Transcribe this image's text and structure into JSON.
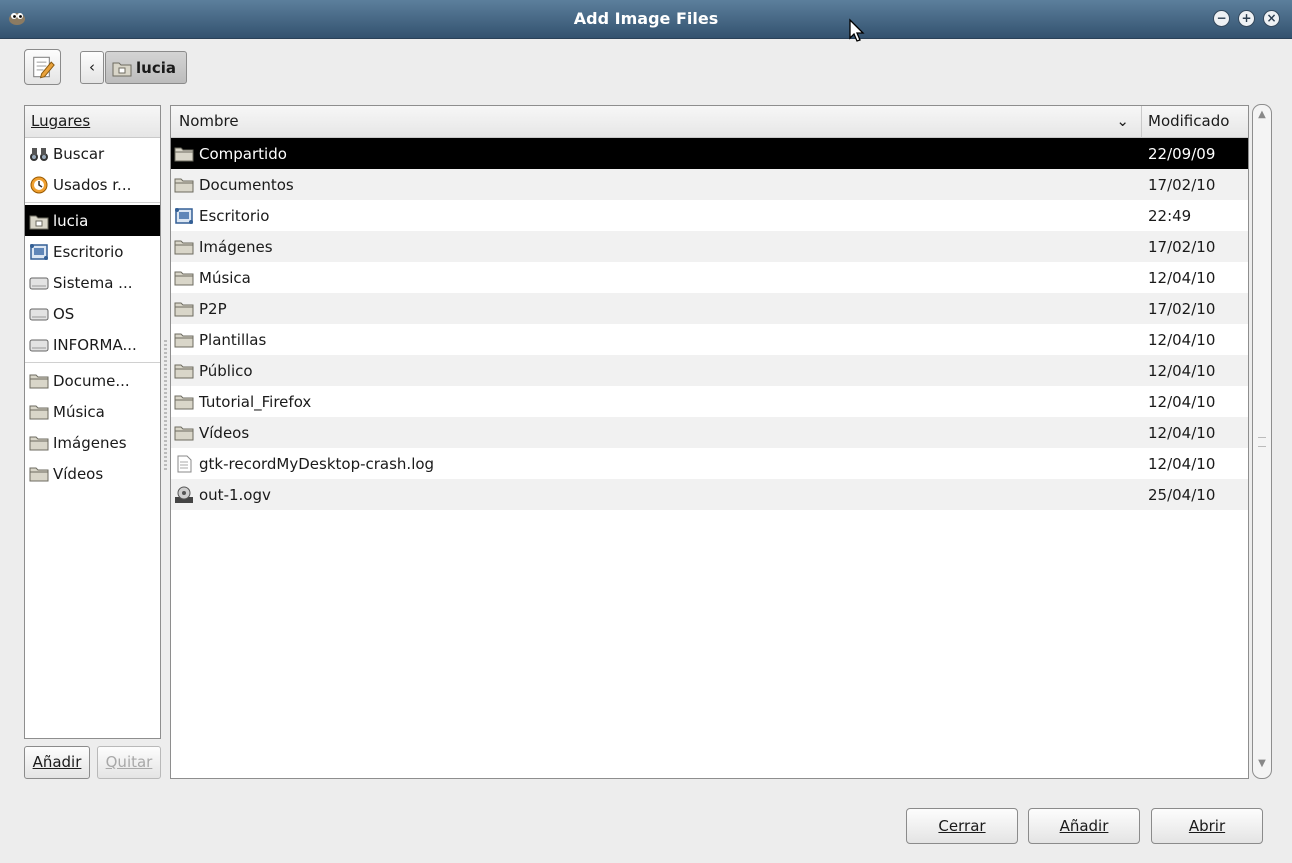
{
  "window": {
    "title": "Add Image Files",
    "app_icon": "gimp-wilber-icon",
    "controls": [
      "minimize-icon",
      "maximize-icon",
      "close-icon"
    ]
  },
  "pathbar": {
    "edit_icon": "pencil-document-icon",
    "back_label": "‹",
    "crumb_label": "lucia"
  },
  "places": {
    "header": "Lugares",
    "items": [
      {
        "label": "Buscar",
        "icon": "binoculars-icon"
      },
      {
        "label": "Usados r...",
        "icon": "recent-icon"
      },
      {
        "label": "lucia",
        "icon": "home-folder-icon",
        "selected": true
      },
      {
        "label": "Escritorio",
        "icon": "desktop-icon"
      },
      {
        "label": "Sistema ...",
        "icon": "drive-icon"
      },
      {
        "label": "OS",
        "icon": "drive-icon"
      },
      {
        "label": "INFORMA...",
        "icon": "drive-icon"
      },
      {
        "label": "Docume...",
        "icon": "folder-icon"
      },
      {
        "label": "Música",
        "icon": "folder-icon"
      },
      {
        "label": "Imágenes",
        "icon": "folder-icon"
      },
      {
        "label": "Vídeos",
        "icon": "folder-icon"
      }
    ],
    "add_label": "Añadir",
    "remove_label": "Quitar"
  },
  "files": {
    "col_name": "Nombre",
    "col_modified": "Modificado",
    "rows": [
      {
        "name": "Compartido",
        "modified": "22/09/09",
        "icon": "folder-icon",
        "selected": true
      },
      {
        "name": "Documentos",
        "modified": "17/02/10",
        "icon": "folder-icon"
      },
      {
        "name": "Escritorio",
        "modified": "22:49",
        "icon": "desktop-icon"
      },
      {
        "name": "Imágenes",
        "modified": "17/02/10",
        "icon": "folder-icon"
      },
      {
        "name": "Música",
        "modified": "12/04/10",
        "icon": "folder-icon"
      },
      {
        "name": "P2P",
        "modified": "17/02/10",
        "icon": "folder-icon"
      },
      {
        "name": "Plantillas",
        "modified": "12/04/10",
        "icon": "folder-icon"
      },
      {
        "name": "Público",
        "modified": "12/04/10",
        "icon": "folder-icon"
      },
      {
        "name": "Tutorial_Firefox",
        "modified": "12/04/10",
        "icon": "folder-icon"
      },
      {
        "name": "Vídeos",
        "modified": "12/04/10",
        "icon": "folder-icon"
      },
      {
        "name": "gtk-recordMyDesktop-crash.log",
        "modified": "12/04/10",
        "icon": "text-file-icon"
      },
      {
        "name": "out-1.ogv",
        "modified": "25/04/10",
        "icon": "video-file-icon"
      }
    ]
  },
  "buttons": {
    "close": "Cerrar",
    "add": "Añadir",
    "open": "Abrir"
  }
}
